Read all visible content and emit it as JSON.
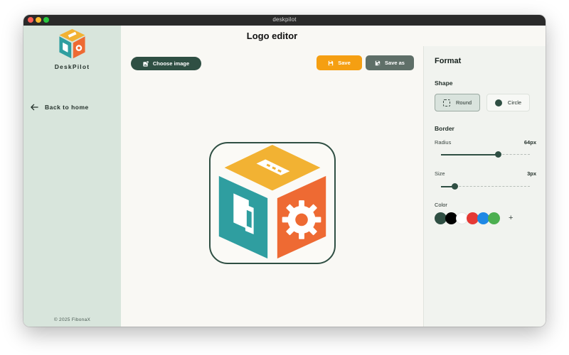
{
  "window": {
    "title": "deskpilot"
  },
  "sidebar": {
    "brand_name": "DeskPilot",
    "back_label": "Back to home",
    "copyright": "© 2025 FibonaX"
  },
  "main": {
    "title": "Logo editor",
    "choose_image_label": "Choose image",
    "save_label": "Save",
    "save_as_label": "Save as"
  },
  "format": {
    "title": "Format",
    "shape_label": "Shape",
    "shape_options": [
      "Round",
      "Circle"
    ],
    "selected_shape": "Round",
    "border_label": "Border",
    "radius": {
      "label": "Radius",
      "value_text": "64px",
      "value": 64,
      "max": 100
    },
    "size": {
      "label": "Size",
      "value_text": "3px",
      "value": 3,
      "max": 20
    },
    "color_label": "Color",
    "colors": [
      "#2f4f43",
      "#000000",
      "#ffffff",
      "#e53935",
      "#1e88e5",
      "#4caf50"
    ],
    "add_color_label": "+"
  },
  "icons": {
    "back": "arrow-left-icon",
    "choose": "image-icon",
    "save": "floppy-disk-icon",
    "save_as": "floppy-disk-edit-icon"
  }
}
